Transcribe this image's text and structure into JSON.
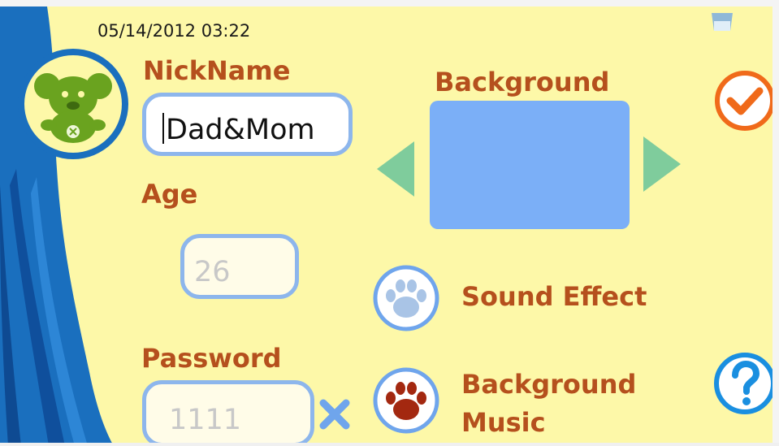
{
  "status": {
    "datetime": "05/14/2012 03:22"
  },
  "profile": {
    "nickname_label": "NickName",
    "nickname_value": "Dad&Mom",
    "age_label": "Age",
    "age_value": "26",
    "password_label": "Password",
    "password_value": "1111"
  },
  "settings": {
    "background_label": "Background",
    "background_color": "#7baff7",
    "sound_effect_label": "Sound Effect",
    "background_music_label_line1": "Background",
    "background_music_label_line2": "Music"
  },
  "icons": {
    "avatar": "green-koala-icon",
    "confirm": "checkmark-icon",
    "help": "question-mark-icon",
    "clear": "clear-x-icon",
    "prev": "arrow-left-icon",
    "next": "arrow-right-icon",
    "sound": "paw-icon",
    "music": "paw-icon",
    "trash": "trash-icon"
  },
  "colors": {
    "screen_bg": "#fdf8a8",
    "label": "#b5501d",
    "field_border": "#8db6ec",
    "curtain_blue": "#1a6fbe",
    "avatar_green": "#6aa31f",
    "confirm_orange": "#f06a1a",
    "help_blue": "#1a8fe0",
    "arrow_teal": "#7fcc9c",
    "paw_off": "#a9c4e6",
    "paw_on": "#a32810"
  }
}
